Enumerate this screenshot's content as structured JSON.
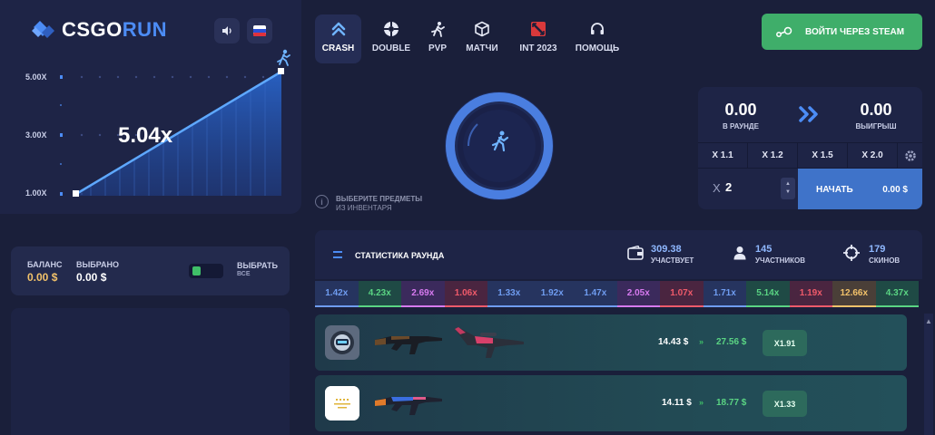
{
  "logo": {
    "part1": "CSGO",
    "part2": "RUN"
  },
  "chart": {
    "current_multiplier": "5.04x",
    "y_ticks": [
      "5.00X",
      "3.00X",
      "1.00X"
    ]
  },
  "nav": [
    {
      "label": "CRASH",
      "icon": "chevrons-up-icon",
      "active": true
    },
    {
      "label": "DOUBLE",
      "icon": "roulette-icon"
    },
    {
      "label": "PVP",
      "icon": "runner-icon"
    },
    {
      "label": "МАТЧИ",
      "icon": "cube-icon"
    },
    {
      "label": "INT 2023",
      "icon": "dota-icon"
    },
    {
      "label": "ПОМОЩЬ",
      "icon": "headset-icon"
    }
  ],
  "steam_button": {
    "label": "ВОЙТИ ЧЕРЕЗ STEAM",
    "icon": "steam-icon"
  },
  "hint": {
    "line1": "ВЫБЕРИТЕ ПРЕДМЕТЫ",
    "line2": "ИЗ ИНВЕНТАРЯ"
  },
  "bet_panel": {
    "in_round_value": "0.00",
    "in_round_label": "В РАУНДЕ",
    "win_value": "0.00",
    "win_label": "ВЫИГРЫШ",
    "multipliers": [
      "X 1.1",
      "X 1.2",
      "X 1.5",
      "X 2.0"
    ],
    "auto_x": "X",
    "auto_value": "2",
    "start_label": "НАЧАТЬ",
    "start_amount": "0.00 $"
  },
  "balance": {
    "balance_label": "БАЛАНС",
    "balance_value": "0.00 $",
    "selected_label": "ВЫБРАНО",
    "selected_value": "0.00 $",
    "select_all_line1": "ВЫБРАТЬ",
    "select_all_line2": "ВСЕ"
  },
  "stats": {
    "title": "СТАТИСТИКА РАУНДА",
    "participating_value": "309.38",
    "participating_label": "УЧАСТВУЕТ",
    "players_value": "145",
    "players_label": "УЧАСТНИКОВ",
    "skins_value": "179",
    "skins_label": "СКИНОВ"
  },
  "history": [
    {
      "value": "1.42x",
      "color": "#6f9cf0",
      "bg": "#26345f"
    },
    {
      "value": "4.23x",
      "color": "#5ad483",
      "bg": "#1f4a45"
    },
    {
      "value": "2.69x",
      "color": "#d77af0",
      "bg": "#3b2a5c"
    },
    {
      "value": "1.06x",
      "color": "#ef5a6a",
      "bg": "#4a2540"
    },
    {
      "value": "1.33x",
      "color": "#6f9cf0",
      "bg": "#26345f"
    },
    {
      "value": "1.92x",
      "color": "#6f9cf0",
      "bg": "#26345f"
    },
    {
      "value": "1.47x",
      "color": "#6f9cf0",
      "bg": "#26345f"
    },
    {
      "value": "2.05x",
      "color": "#d77af0",
      "bg": "#3b2a5c"
    },
    {
      "value": "1.07x",
      "color": "#ef5a6a",
      "bg": "#4a2540"
    },
    {
      "value": "1.71x",
      "color": "#6f9cf0",
      "bg": "#26345f"
    },
    {
      "value": "5.14x",
      "color": "#5ad483",
      "bg": "#1f4a45"
    },
    {
      "value": "1.19x",
      "color": "#ef5a6a",
      "bg": "#4a2540"
    },
    {
      "value": "12.66x",
      "color": "#f2c26a",
      "bg": "#4a3f38"
    },
    {
      "value": "4.37x",
      "color": "#5ad483",
      "bg": "#1f4a45"
    }
  ],
  "bets": [
    {
      "bet": "14.43 $",
      "win": "27.56 $",
      "mult": "X1.91"
    },
    {
      "bet": "14.11 $",
      "win": "18.77 $",
      "mult": "X1.33"
    }
  ]
}
